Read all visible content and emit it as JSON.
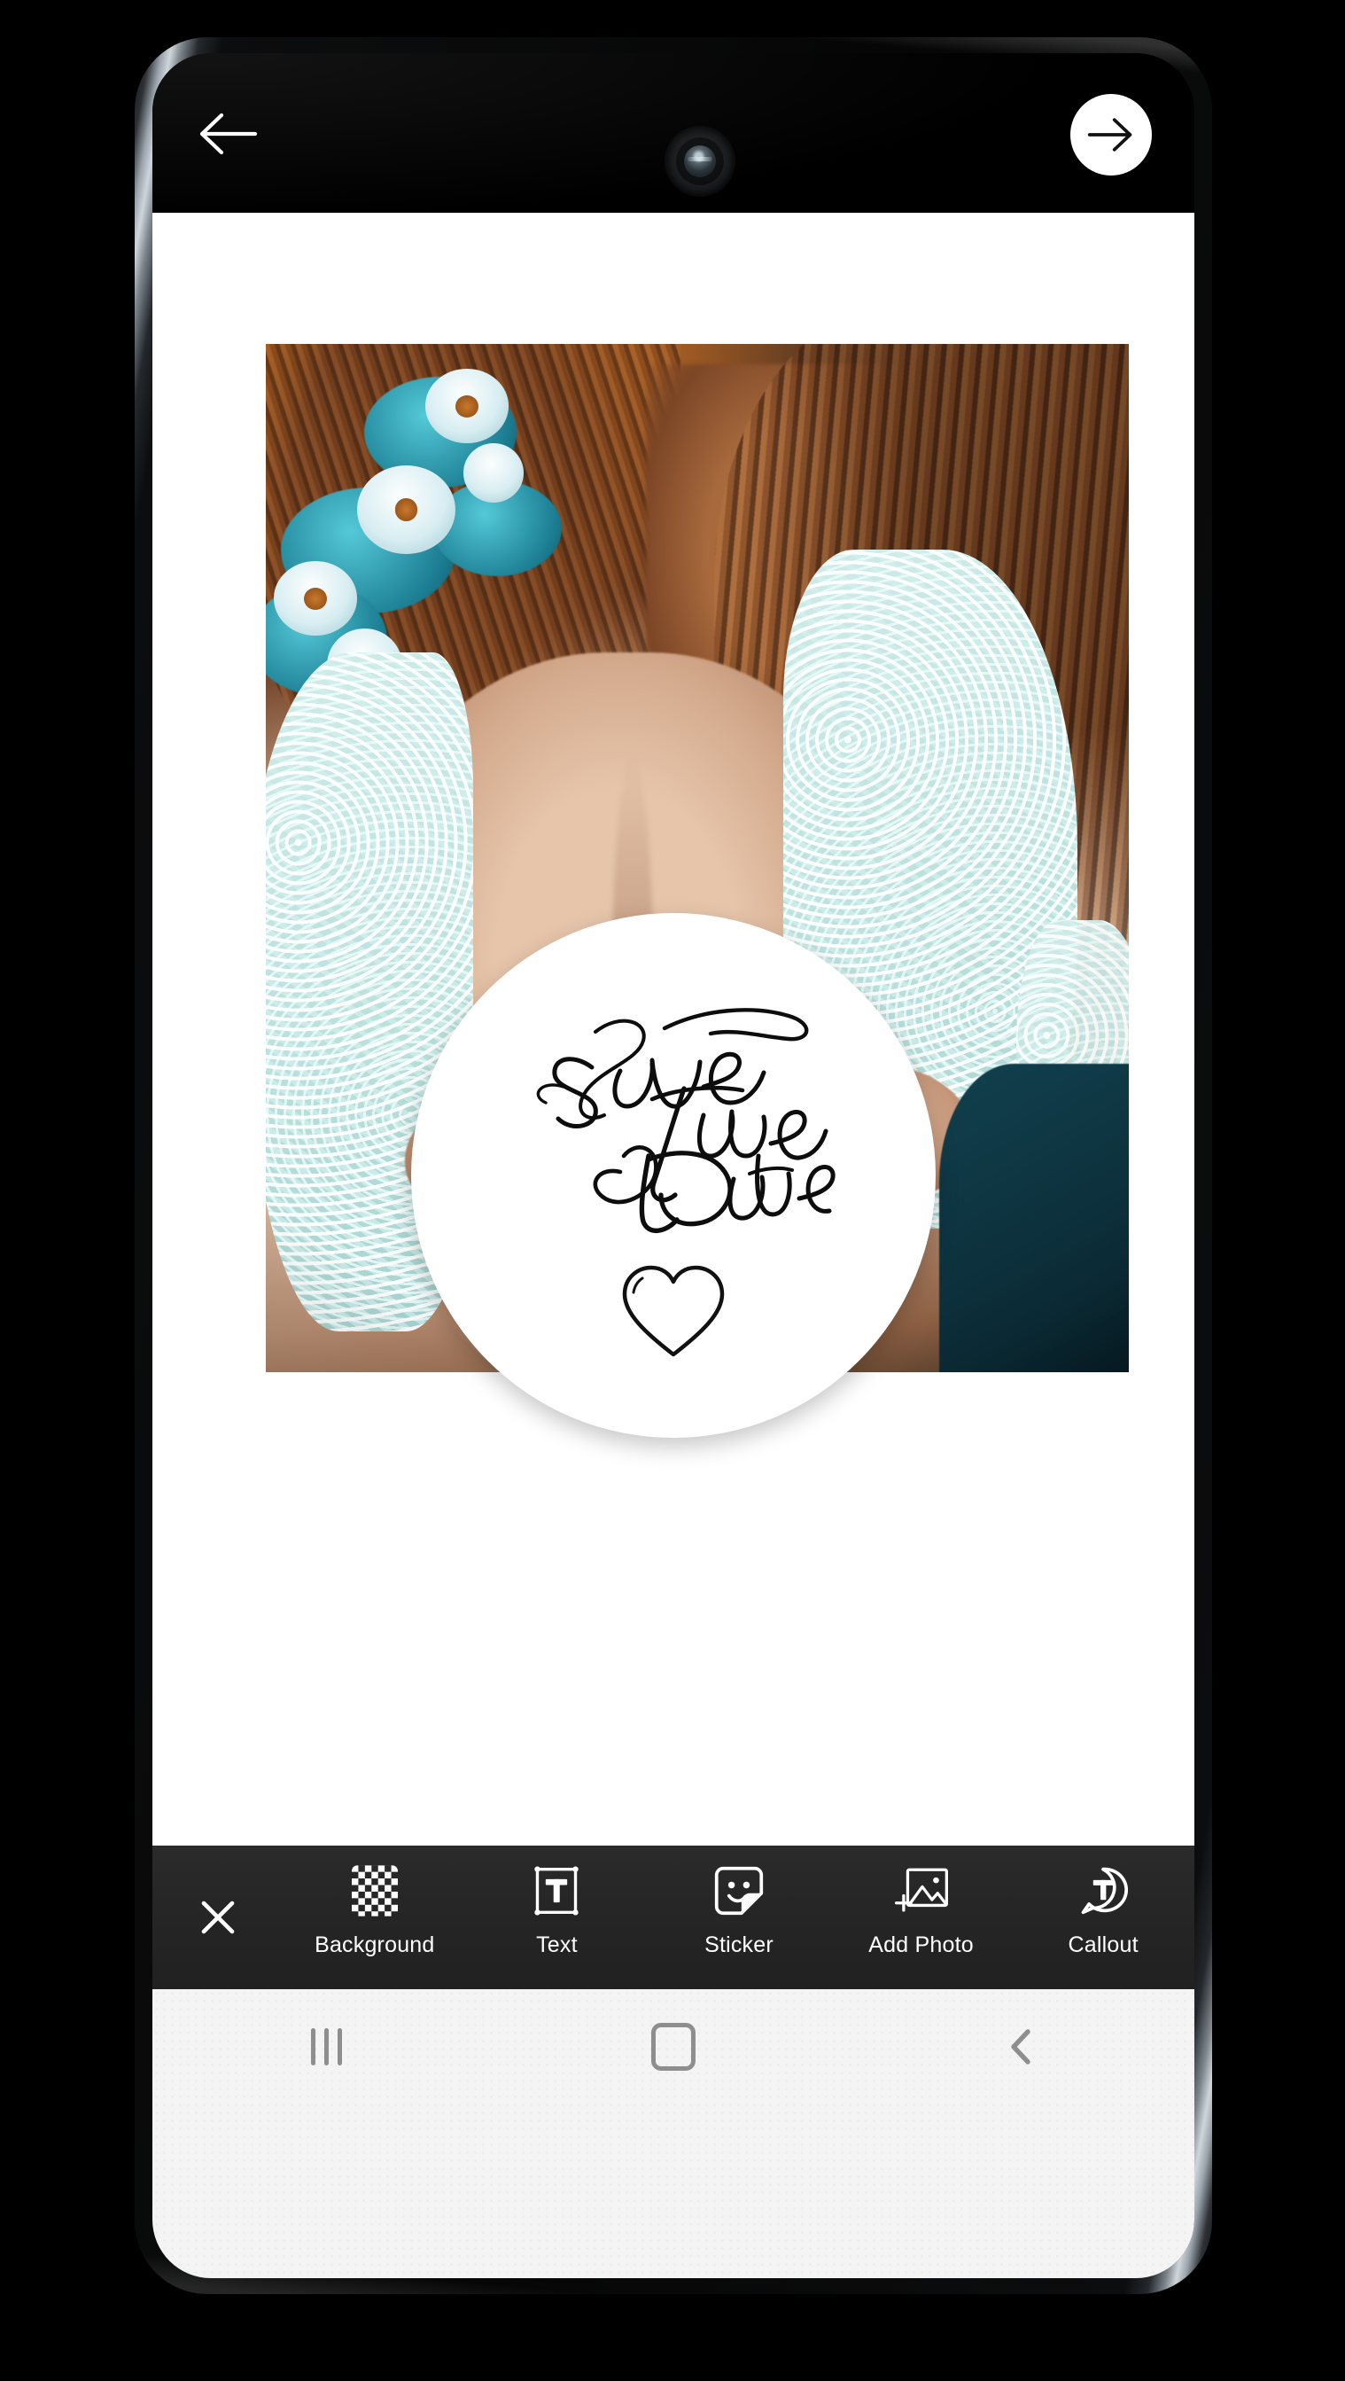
{
  "app": {
    "name": "photo-collage-editor",
    "topbar": {
      "back_icon": "arrow-left-icon",
      "next_icon": "arrow-right-icon",
      "camera_icon": "front-camera-punch-hole"
    }
  },
  "canvas": {
    "background_color": "#ffffff",
    "photo": {
      "alt": "wedding couple embracing, bride in lace dress with floral crown",
      "dominant_colors": [
        "#8a4f28",
        "#e8821f",
        "#1d7f94",
        "#dff3f0",
        "#0b2b36"
      ]
    },
    "sticker": {
      "name": "save-the-date-sticker",
      "shape": "circle",
      "background_color": "#ffffff",
      "line1": "Save",
      "line2": "The",
      "line3": "Date",
      "decoration": "heart-outline-icon"
    }
  },
  "toolbar": {
    "background_color": "#262626",
    "close_icon": "close-icon",
    "close_label": "Close",
    "items": [
      {
        "label": "Background",
        "icon": "checkerboard-icon"
      },
      {
        "label": "Text",
        "icon": "text-box-icon"
      },
      {
        "label": "Sticker",
        "icon": "sticker-smiley-icon"
      },
      {
        "label": "Add Photo",
        "icon": "add-image-icon"
      },
      {
        "label": "Callout",
        "icon": "speech-bubble-text-icon"
      }
    ]
  },
  "navbar": {
    "background_color": "#f4f4f4",
    "icon_color": "#8e8e8e",
    "buttons": [
      {
        "name": "recents",
        "icon": "recents-bars-icon"
      },
      {
        "name": "home",
        "icon": "home-square-icon"
      },
      {
        "name": "back",
        "icon": "chevron-left-icon"
      }
    ]
  }
}
